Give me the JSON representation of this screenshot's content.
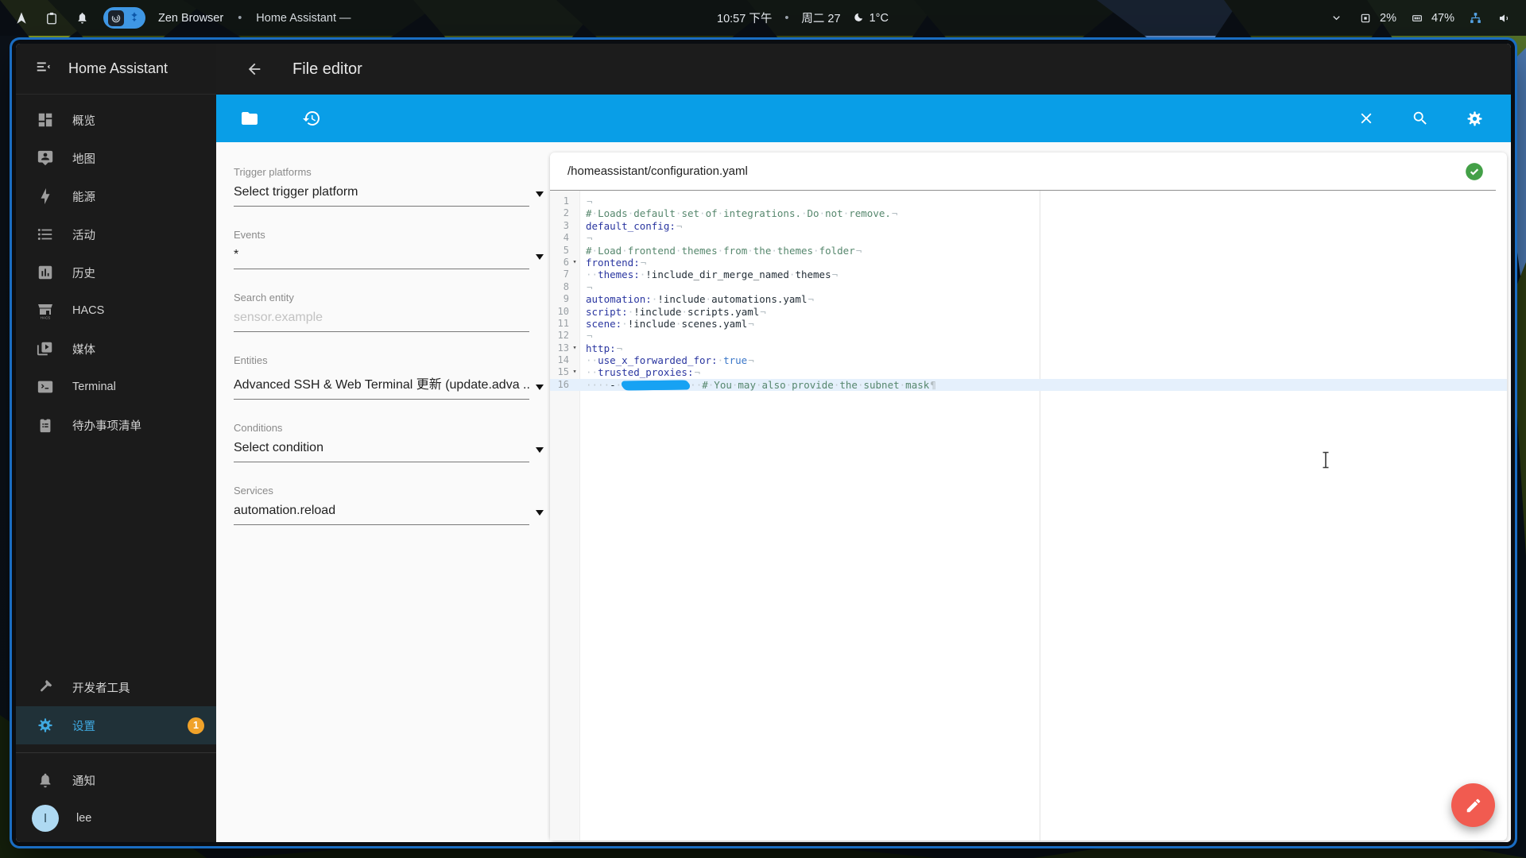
{
  "colors": {
    "accent": "#099ee7",
    "sidebar_bg": "#1b1b1b",
    "header_bg": "#1c1c1c",
    "active_item": "#3fa9e0",
    "active_item_bg": "#203138",
    "badge": "#f0a229",
    "fab": "#f15b50",
    "check": "#43a047",
    "redaction": "#17a2f3",
    "content_bg": "#fafafa",
    "card_bg": "#ffffff",
    "active_line": "#e5f0fc",
    "code_comment": "#56876d",
    "code_key": "#2a36a0",
    "code_atom": "#3a76c8",
    "code_text": "#242f38"
  },
  "os_bar": {
    "app_name": "Zen Browser",
    "separator": "•",
    "window_title": "Home Assistant —",
    "time": "10:57 下午",
    "date": "周二 27",
    "temperature": "1°C",
    "cpu_usage": "2%",
    "memory_usage": "47%"
  },
  "sidebar": {
    "title": "Home Assistant",
    "items": [
      {
        "label": "概览"
      },
      {
        "label": "地图"
      },
      {
        "label": "能源"
      },
      {
        "label": "活动"
      },
      {
        "label": "历史"
      },
      {
        "label": "HACS",
        "icon_text": "HACS"
      },
      {
        "label": "媒体"
      },
      {
        "label": "Terminal"
      },
      {
        "label": "待办事项清单"
      }
    ],
    "dev_tools": {
      "label": "开发者工具"
    },
    "settings": {
      "label": "设置",
      "badge": "1"
    },
    "notifications": {
      "label": "通知"
    },
    "profile": {
      "name": "lee",
      "avatar_letter": "l"
    }
  },
  "header": {
    "title": "File editor"
  },
  "panel": {
    "fields": [
      {
        "label": "Trigger platforms",
        "value": "Select trigger platform"
      },
      {
        "label": "Events",
        "value": "*"
      },
      {
        "label": "Search entity",
        "placeholder": "sensor.example"
      },
      {
        "label": "Entities",
        "value": "Advanced SSH & Web Terminal 更新 (update.adva ..."
      },
      {
        "label": "Conditions",
        "value": "Select condition"
      },
      {
        "label": "Services",
        "value": "automation.reload"
      }
    ]
  },
  "editor": {
    "path": "/homeassistant/configuration.yaml",
    "status": "valid",
    "lines": [
      {
        "n": 1,
        "segs": [
          {
            "c": "eol",
            "t": "¬"
          }
        ]
      },
      {
        "n": 2,
        "segs": [
          {
            "c": "com",
            "t": "#·Loads·default·set·of·integrations.·Do·not·remove."
          },
          {
            "c": "eol",
            "t": "¬"
          }
        ]
      },
      {
        "n": 3,
        "segs": [
          {
            "c": "key",
            "t": "default_config:"
          },
          {
            "c": "eol",
            "t": "¬"
          }
        ]
      },
      {
        "n": 4,
        "segs": [
          {
            "c": "eol",
            "t": "¬"
          }
        ]
      },
      {
        "n": 5,
        "segs": [
          {
            "c": "com",
            "t": "#·Load·frontend·themes·from·the·themes·folder"
          },
          {
            "c": "eol",
            "t": "¬"
          }
        ]
      },
      {
        "n": 6,
        "fold": true,
        "segs": [
          {
            "c": "key",
            "t": "frontend:"
          },
          {
            "c": "eol",
            "t": "¬"
          }
        ]
      },
      {
        "n": 7,
        "segs": [
          {
            "c": "txt",
            "t": "··"
          },
          {
            "c": "key",
            "t": "themes:"
          },
          {
            "c": "txt",
            "t": "·!include_dir_merge_named·themes"
          },
          {
            "c": "eol",
            "t": "¬"
          }
        ]
      },
      {
        "n": 8,
        "segs": [
          {
            "c": "eol",
            "t": "¬"
          }
        ]
      },
      {
        "n": 9,
        "segs": [
          {
            "c": "key",
            "t": "automation:"
          },
          {
            "c": "txt",
            "t": "·!include·automations.yaml"
          },
          {
            "c": "eol",
            "t": "¬"
          }
        ]
      },
      {
        "n": 10,
        "segs": [
          {
            "c": "key",
            "t": "script:"
          },
          {
            "c": "txt",
            "t": "·!include·scripts.yaml"
          },
          {
            "c": "eol",
            "t": "¬"
          }
        ]
      },
      {
        "n": 11,
        "segs": [
          {
            "c": "key",
            "t": "scene:"
          },
          {
            "c": "txt",
            "t": "·!include·scenes.yaml"
          },
          {
            "c": "eol",
            "t": "¬"
          }
        ]
      },
      {
        "n": 12,
        "segs": [
          {
            "c": "eol",
            "t": "¬"
          }
        ]
      },
      {
        "n": 13,
        "fold": true,
        "segs": [
          {
            "c": "key",
            "t": "http:"
          },
          {
            "c": "eol",
            "t": "¬"
          }
        ]
      },
      {
        "n": 14,
        "segs": [
          {
            "c": "txt",
            "t": "··"
          },
          {
            "c": "key",
            "t": "use_x_forwarded_for:"
          },
          {
            "c": "txt",
            "t": "·"
          },
          {
            "c": "atom",
            "t": "true"
          },
          {
            "c": "eol",
            "t": "¬"
          }
        ]
      },
      {
        "n": 15,
        "fold": true,
        "segs": [
          {
            "c": "txt",
            "t": "··"
          },
          {
            "c": "key",
            "t": "trusted_proxies:"
          },
          {
            "c": "eol",
            "t": "¬"
          }
        ]
      },
      {
        "n": 16,
        "active": true,
        "segs": [
          {
            "c": "txt",
            "t": "····-·"
          },
          {
            "c": "redact",
            "t": ""
          },
          {
            "c": "txt",
            "t": "··"
          },
          {
            "c": "com",
            "t": "#·You·may·also·provide·the·subnet·mask"
          },
          {
            "c": "eol",
            "t": "¶"
          }
        ]
      }
    ]
  }
}
